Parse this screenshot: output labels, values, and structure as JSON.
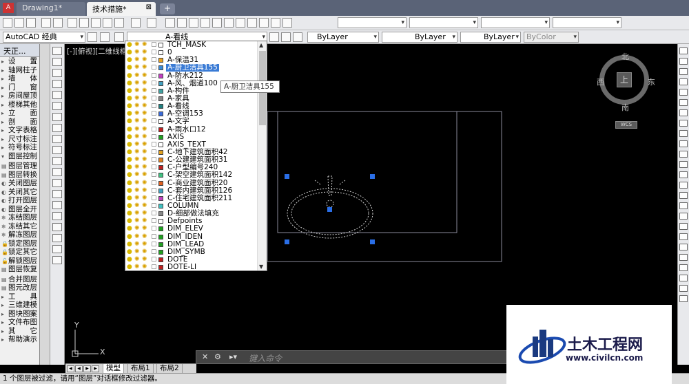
{
  "tabs": {
    "drawing1": "Drawing1*",
    "active": "技术措施*",
    "close_glyph": "⊠"
  },
  "toolbar": {
    "workspace": "AutoCAD 经典",
    "current_layer": "A-看线",
    "color": "ByLayer",
    "linetype": "ByLayer",
    "lineweight": "ByLayer",
    "plotstyle": "ByColor"
  },
  "tz_panel": {
    "title": "天正...",
    "items": [
      {
        "mark": "▸",
        "label": "设　　置"
      },
      {
        "mark": "▸",
        "label": "轴网柱子"
      },
      {
        "mark": "▸",
        "label": "墙　　体"
      },
      {
        "mark": "▸",
        "label": "门　　窗"
      },
      {
        "mark": "▸",
        "label": "房间屋顶"
      },
      {
        "mark": "▸",
        "label": "楼梯其他"
      },
      {
        "mark": "▸",
        "label": "立　　面"
      },
      {
        "mark": "▸",
        "label": "剖　　面"
      },
      {
        "mark": "▸",
        "label": "文字表格"
      },
      {
        "mark": "▸",
        "label": "尺寸标注"
      },
      {
        "mark": "▸",
        "label": "符号标注"
      },
      {
        "mark": "▾",
        "label": "图层控制"
      }
    ],
    "layer_items": [
      {
        "mark": "▤",
        "label": "图层管理"
      },
      {
        "mark": "▤",
        "label": "图层转换"
      },
      {
        "mark": "◐",
        "label": "关闭图层"
      },
      {
        "mark": "◐",
        "label": "关闭其它"
      },
      {
        "mark": "◐",
        "label": "打开图层"
      },
      {
        "mark": "◐",
        "label": "图层全开"
      },
      {
        "mark": "❄",
        "label": "冻结图层"
      },
      {
        "mark": "❄",
        "label": "冻结其它"
      },
      {
        "mark": "❄",
        "label": "解冻图层"
      },
      {
        "mark": "🔒",
        "label": "锁定图层"
      },
      {
        "mark": "🔒",
        "label": "锁定其它"
      },
      {
        "mark": "🔓",
        "label": "解锁图层"
      },
      {
        "mark": "▤",
        "label": "图层恢复"
      }
    ],
    "more_items": [
      {
        "mark": "▤",
        "label": "合并图层"
      },
      {
        "mark": "▤",
        "label": "图元改层"
      },
      {
        "mark": "▸",
        "label": "工　　具"
      },
      {
        "mark": "▸",
        "label": "三维建模"
      },
      {
        "mark": "▸",
        "label": "图块图案"
      },
      {
        "mark": "▸",
        "label": "文件布图"
      },
      {
        "mark": "▸",
        "label": "其　　它"
      },
      {
        "mark": "▸",
        "label": "帮助演示"
      }
    ]
  },
  "canvas": {
    "view_label": "[-][俯视][二维线框]"
  },
  "layer_list": {
    "rows": [
      {
        "name": "TCH_MASK",
        "color": "#ffffff"
      },
      {
        "name": "0",
        "color": "#ffffff"
      },
      {
        "name": "A-保温31",
        "color": "#e8a020"
      },
      {
        "name": "A-厨卫洁具155",
        "color": "#3a8ad6",
        "selected": true
      },
      {
        "name": "A-防水212",
        "color": "#c040c0"
      },
      {
        "name": "A-风、烟道100",
        "color": "#40a0c0"
      },
      {
        "name": "A-构件",
        "color": "#40a0a0"
      },
      {
        "name": "A-家具",
        "color": "#888888"
      },
      {
        "name": "A-看线",
        "color": "#208080"
      },
      {
        "name": "A-空调153",
        "color": "#3a6ad6"
      },
      {
        "name": "A-文字",
        "color": "#ffffff"
      },
      {
        "name": "A-雨水口12",
        "color": "#c02020"
      },
      {
        "name": "AXIS",
        "color": "#20a020"
      },
      {
        "name": "AXIS_TEXT",
        "color": "#ffffff"
      },
      {
        "name": "C-地下建筑面积42",
        "color": "#e0a020"
      },
      {
        "name": "C-公建建筑面积31",
        "color": "#e08020"
      },
      {
        "name": "C-户型编号240",
        "color": "#c02020"
      },
      {
        "name": "C-架空建筑面积142",
        "color": "#40c080"
      },
      {
        "name": "C-商业建筑面积20",
        "color": "#e06020"
      },
      {
        "name": "C-套内建筑面积126",
        "color": "#40a0c0"
      },
      {
        "name": "C-住宅建筑面积211",
        "color": "#c040c0"
      },
      {
        "name": "COLUMN",
        "color": "#40c0c0"
      },
      {
        "name": "D-细部做法填充",
        "color": "#888888"
      },
      {
        "name": "Defpoints",
        "color": "#ffffff"
      },
      {
        "name": "DIM_ELEV",
        "color": "#20a020"
      },
      {
        "name": "DIM_IDEN",
        "color": "#20a020"
      },
      {
        "name": "DIM_LEAD",
        "color": "#20a020"
      },
      {
        "name": "DIM_SYMB",
        "color": "#20a020"
      },
      {
        "name": "DOTE",
        "color": "#c02020"
      },
      {
        "name": "DOTE-LI",
        "color": "#c02020"
      }
    ]
  },
  "tooltip": "A-厨卫洁具155",
  "viewcube": {
    "north": "北",
    "south": "南",
    "east": "东",
    "west": "西",
    "top": "上",
    "wcs": "WCS"
  },
  "ucs": {
    "x": "X",
    "y": "Y"
  },
  "layout_tabs": [
    "模型",
    "布局1",
    "布局2"
  ],
  "command": {
    "placeholder": "键入命令"
  },
  "status": "1 个图层被过滤，请用“图层”对话框修改过滤器。",
  "watermark": {
    "name": "土木工程网",
    "url": "www.civilcn.com"
  }
}
